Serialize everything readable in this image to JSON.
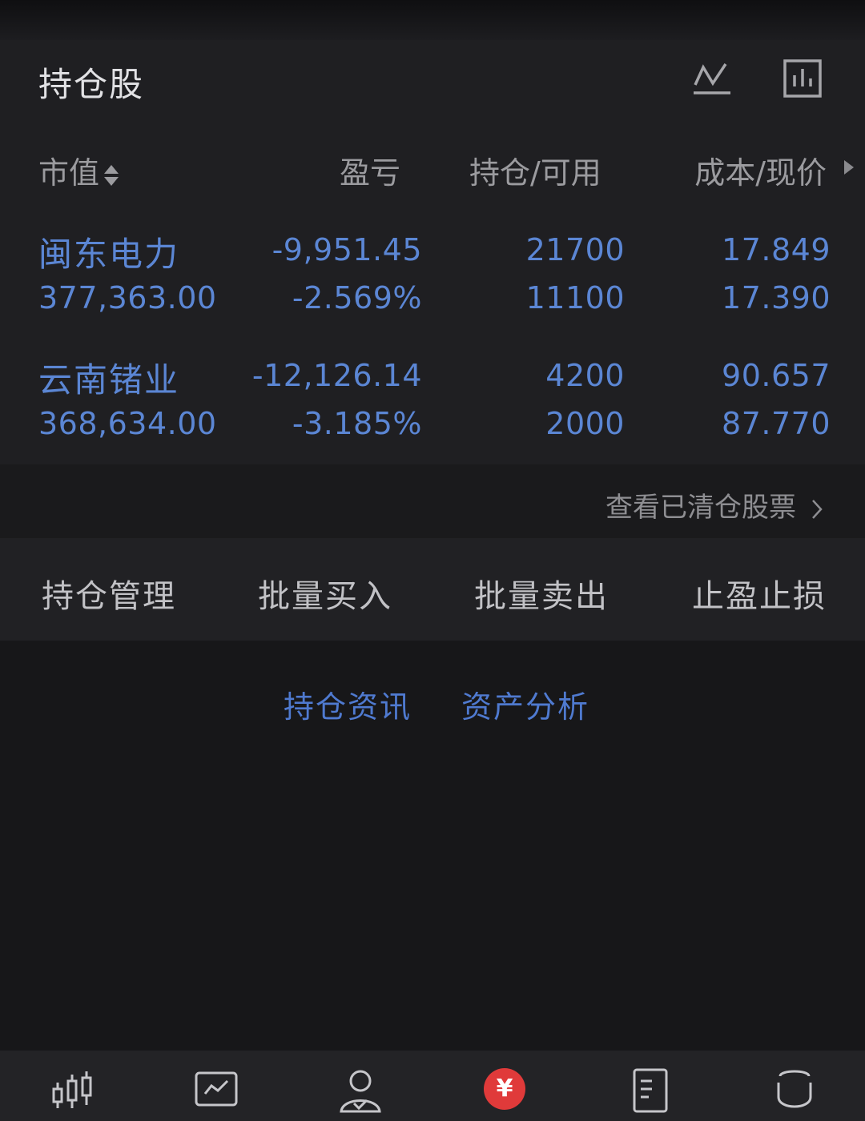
{
  "header": {
    "title": "持仓股"
  },
  "columns": {
    "market_value": "市值",
    "profit_loss": "盈亏",
    "position_available": "持仓/可用",
    "cost_price": "成本/现价"
  },
  "holdings": [
    {
      "name": "闽东电力",
      "market_value": "377,363.00",
      "profit_loss": "-9,951.45",
      "profit_loss_pct": "-2.569%",
      "position": "21700",
      "available": "11100",
      "cost": "17.849",
      "price": "17.390"
    },
    {
      "name": "云南锗业",
      "market_value": "368,634.00",
      "profit_loss": "-12,126.14",
      "profit_loss_pct": "-3.185%",
      "position": "4200",
      "available": "2000",
      "cost": "90.657",
      "price": "87.770"
    }
  ],
  "cleared_link": "查看已清仓股票",
  "actions": [
    "持仓管理",
    "批量买入",
    "批量卖出",
    "止盈止损"
  ],
  "links": [
    "持仓资讯",
    "资产分析"
  ],
  "tabbar": {
    "icons": [
      "candlestick-icon",
      "chart-icon",
      "user-icon",
      "yuan-icon",
      "document-icon",
      "cup-icon"
    ],
    "trade_symbol": "¥"
  },
  "colors": {
    "accent_blue": "#5b86d4",
    "link_blue": "#4f7ad0",
    "trade_red": "#e03a3a"
  }
}
